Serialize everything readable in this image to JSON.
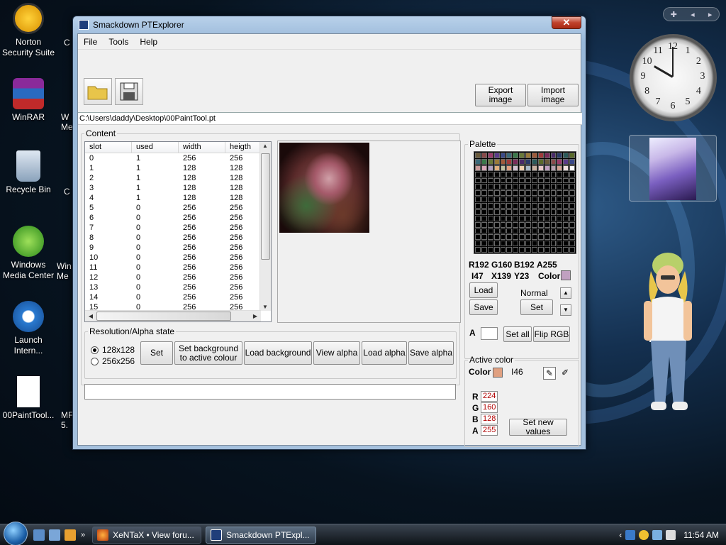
{
  "desktop": {
    "icons": [
      {
        "label": "Norton Security Suite"
      },
      {
        "label": "WinRAR"
      },
      {
        "label": "Recycle Bin"
      },
      {
        "label": "Windows Media Center"
      },
      {
        "label": "Launch Intern..."
      },
      {
        "label": "00PaintTool..."
      }
    ],
    "partial_icons": [
      "C",
      "W Me",
      "C",
      "Win Me",
      "MF 5."
    ]
  },
  "window": {
    "title": "Smackdown PTExplorer",
    "close_label": "✕",
    "menu": [
      "File",
      "Tools",
      "Help"
    ],
    "export_label": "Export image",
    "import_label": "Import image",
    "path": "C:\\Users\\daddy\\Desktop\\00PaintTool.pt",
    "content_legend": "Content",
    "table": {
      "headers": [
        "slot",
        "used",
        "width",
        "heigth"
      ],
      "rows": [
        [
          "0",
          "1",
          "256",
          "256"
        ],
        [
          "1",
          "1",
          "128",
          "128"
        ],
        [
          "2",
          "1",
          "128",
          "128"
        ],
        [
          "3",
          "1",
          "128",
          "128"
        ],
        [
          "4",
          "1",
          "128",
          "128"
        ],
        [
          "5",
          "0",
          "256",
          "256"
        ],
        [
          "6",
          "0",
          "256",
          "256"
        ],
        [
          "7",
          "0",
          "256",
          "256"
        ],
        [
          "8",
          "0",
          "256",
          "256"
        ],
        [
          "9",
          "0",
          "256",
          "256"
        ],
        [
          "10",
          "0",
          "256",
          "256"
        ],
        [
          "11",
          "0",
          "256",
          "256"
        ],
        [
          "12",
          "0",
          "256",
          "256"
        ],
        [
          "13",
          "0",
          "256",
          "256"
        ],
        [
          "14",
          "0",
          "256",
          "256"
        ],
        [
          "15",
          "0",
          "256",
          "256"
        ]
      ]
    },
    "resolution": {
      "legend": "Resolution/Alpha state",
      "option1": "128x128",
      "option2": "256x256",
      "selected": "128x128",
      "set_label": "Set",
      "set_bg_label": "Set background to active colour",
      "load_bg_label": "Load background",
      "view_alpha_label": "View alpha",
      "load_alpha_label": "Load alpha",
      "save_alpha_label": "Save alpha"
    },
    "palette": {
      "legend": "Palette",
      "r": "R192",
      "g": "G160",
      "b": "B192",
      "a": "A255",
      "i": "I47",
      "x": "X139",
      "y": "Y23",
      "color_label": "Color",
      "color_value": "#c0a0c0",
      "load_label": "Load",
      "save_label": "Save",
      "mode_label": "Normal",
      "set_label": "Set",
      "alpha_label": "A",
      "alpha_value": "",
      "set_all_label": "Set all",
      "flip_rgb_label": "Flip RGB"
    },
    "active_color": {
      "legend": "Active color",
      "color_label": "Color",
      "color_value": "#e0a080",
      "index": "I46",
      "r_label": "R",
      "r_value": "224",
      "g_label": "G",
      "g_value": "160",
      "b_label": "B",
      "b_value": "128",
      "a_label": "A",
      "a_value": "255",
      "set_new_label": "Set new values"
    }
  },
  "taskbar": {
    "tasks": [
      {
        "label": "XeNTaX • View foru..."
      },
      {
        "label": "Smackdown PTExpl..."
      }
    ],
    "time": "11:54 AM"
  },
  "sidebar": {
    "clock_numbers": [
      "12",
      "1",
      "2",
      "3",
      "4",
      "5",
      "6",
      "7",
      "8",
      "9",
      "10",
      "11"
    ]
  }
}
